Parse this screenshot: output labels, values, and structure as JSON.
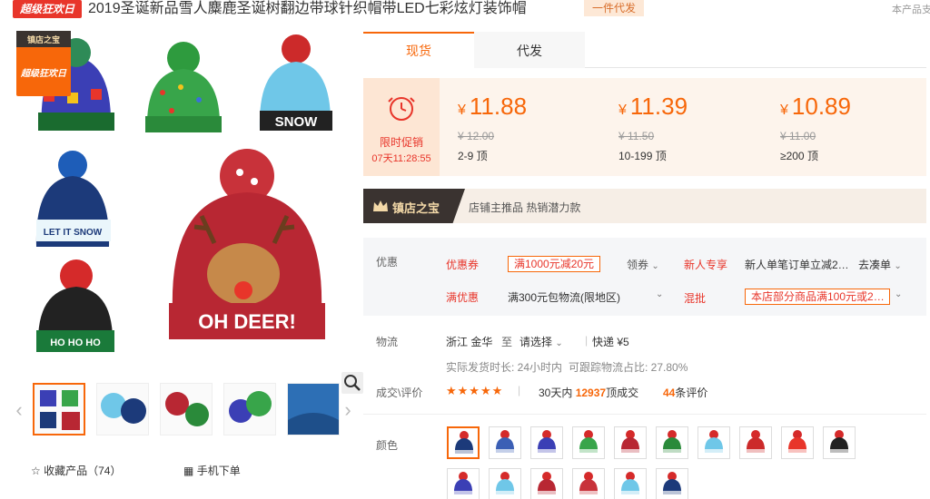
{
  "header": {
    "sale_badge": "超级狂欢日",
    "title": "2019圣诞新品雪人麋鹿圣诞树翻边带球针织帽带LED七彩炫灯装饰帽",
    "dropship_tag": "一件代发",
    "right_text": "本产品支"
  },
  "gallery": {
    "logo_text": "超级狂欢日",
    "logo_shop": "镇店之宝",
    "main_hat_caption": "OH DEER!",
    "hats_text": [
      "SNOW",
      "LET IT SNOW",
      "HO HO HO"
    ],
    "zoom_icon": "magnifier-icon"
  },
  "thumbs": {
    "count": 5,
    "active_index": 0
  },
  "actions": {
    "favorite_label": "收藏产品（74）",
    "mobile_label": "手机下单"
  },
  "tabs": [
    {
      "label": "现货",
      "active": true
    },
    {
      "label": "代发",
      "active": false
    }
  ],
  "price": {
    "promo_label": "限时促销",
    "promo_time": "07天11:28:55",
    "currency": "¥",
    "tiers": [
      {
        "price": "11.88",
        "old": "¥ 12.00",
        "range": "2-9 顶"
      },
      {
        "price": "11.39",
        "old": "¥ 11.50",
        "range": "10-199 顶"
      },
      {
        "price": "10.89",
        "old": "¥ 11.00",
        "range": "≥200 顶"
      }
    ]
  },
  "shop_banner": {
    "name": "镇店之宝",
    "text": "店铺主推品  热销潜力款"
  },
  "promotions": {
    "label": "优惠",
    "coupon_label": "优惠券",
    "coupon_value": "满1000元减20元",
    "claim_label": "领券",
    "newuser_label": "新人专享",
    "newuser_text": "新人单笔订单立减2…",
    "go_label": "去凑单",
    "mjy_label": "满优惠",
    "mjy_text": "满300元包物流(限地区)",
    "mix_label": "混批",
    "mix_value": "本店部分商品满100元或2…"
  },
  "logistics": {
    "label": "物流",
    "from": "浙江 金华",
    "to_word": "至",
    "dest": "请选择",
    "express": "快递 ¥5",
    "ship_time": "实际发货时长: 24小时内",
    "track_rate": "可跟踪物流占比: 27.80%"
  },
  "reviews": {
    "label": "成交\\评价",
    "stars": "★★★★★",
    "sold_prefix": "30天内",
    "sold_count": "12937",
    "sold_suffix": "顶成交",
    "review_count": "44",
    "review_suffix": "条评价"
  },
  "colors": {
    "label": "颜色",
    "swatches": 16,
    "active_index": 0
  },
  "palette": {
    "accent": "#f7670a",
    "red": "#e8352a",
    "promo_bg": "#fde6d4"
  }
}
